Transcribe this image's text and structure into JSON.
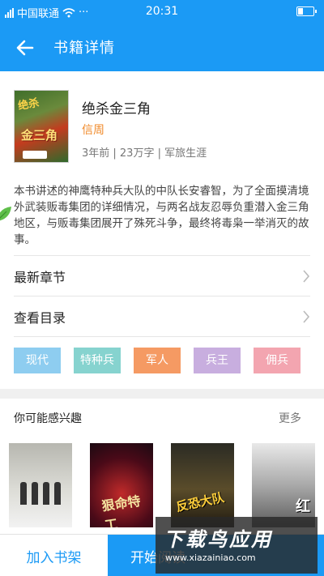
{
  "status": {
    "carrier": "中国联通",
    "time": "20:31",
    "dots": "···"
  },
  "app_bar": {
    "title": "书籍详情"
  },
  "book": {
    "cover_text": "绝杀金三角",
    "title": "绝杀金三角",
    "author": "信周",
    "meta": "3年前 | 23万字 | 军旅生涯",
    "description": "本书讲述的神鹰特种兵大队的中队长安睿智，为了全面摸清境外武装贩毒集团的详细情况，与两名战友忍辱负重潜入金三角地区，与贩毒集团展开了殊死斗争，最终将毒枭一举消灭的故事。"
  },
  "menu": {
    "latest_chapter": "最新章节",
    "catalog": "查看目录"
  },
  "tags": [
    {
      "label": "现代",
      "color": "#8ecdf0"
    },
    {
      "label": "特种兵",
      "color": "#86d3cf"
    },
    {
      "label": "军人",
      "color": "#f59a63"
    },
    {
      "label": "兵王",
      "color": "#c8aedf"
    },
    {
      "label": "佣兵",
      "color": "#f3a5b0"
    }
  ],
  "recommend": {
    "title": "你可能感兴趣",
    "more": "更多",
    "items": [
      {
        "cover_text": ""
      },
      {
        "cover_text": "狠命特工"
      },
      {
        "cover_text": "反恐大队"
      },
      {
        "cover_text": "红"
      }
    ]
  },
  "actions": {
    "add_shelf": "加入书架",
    "start_read": "开始阅读"
  },
  "watermark": {
    "main": "下载鸟应用",
    "sub": "www.xiazainiao.com"
  }
}
